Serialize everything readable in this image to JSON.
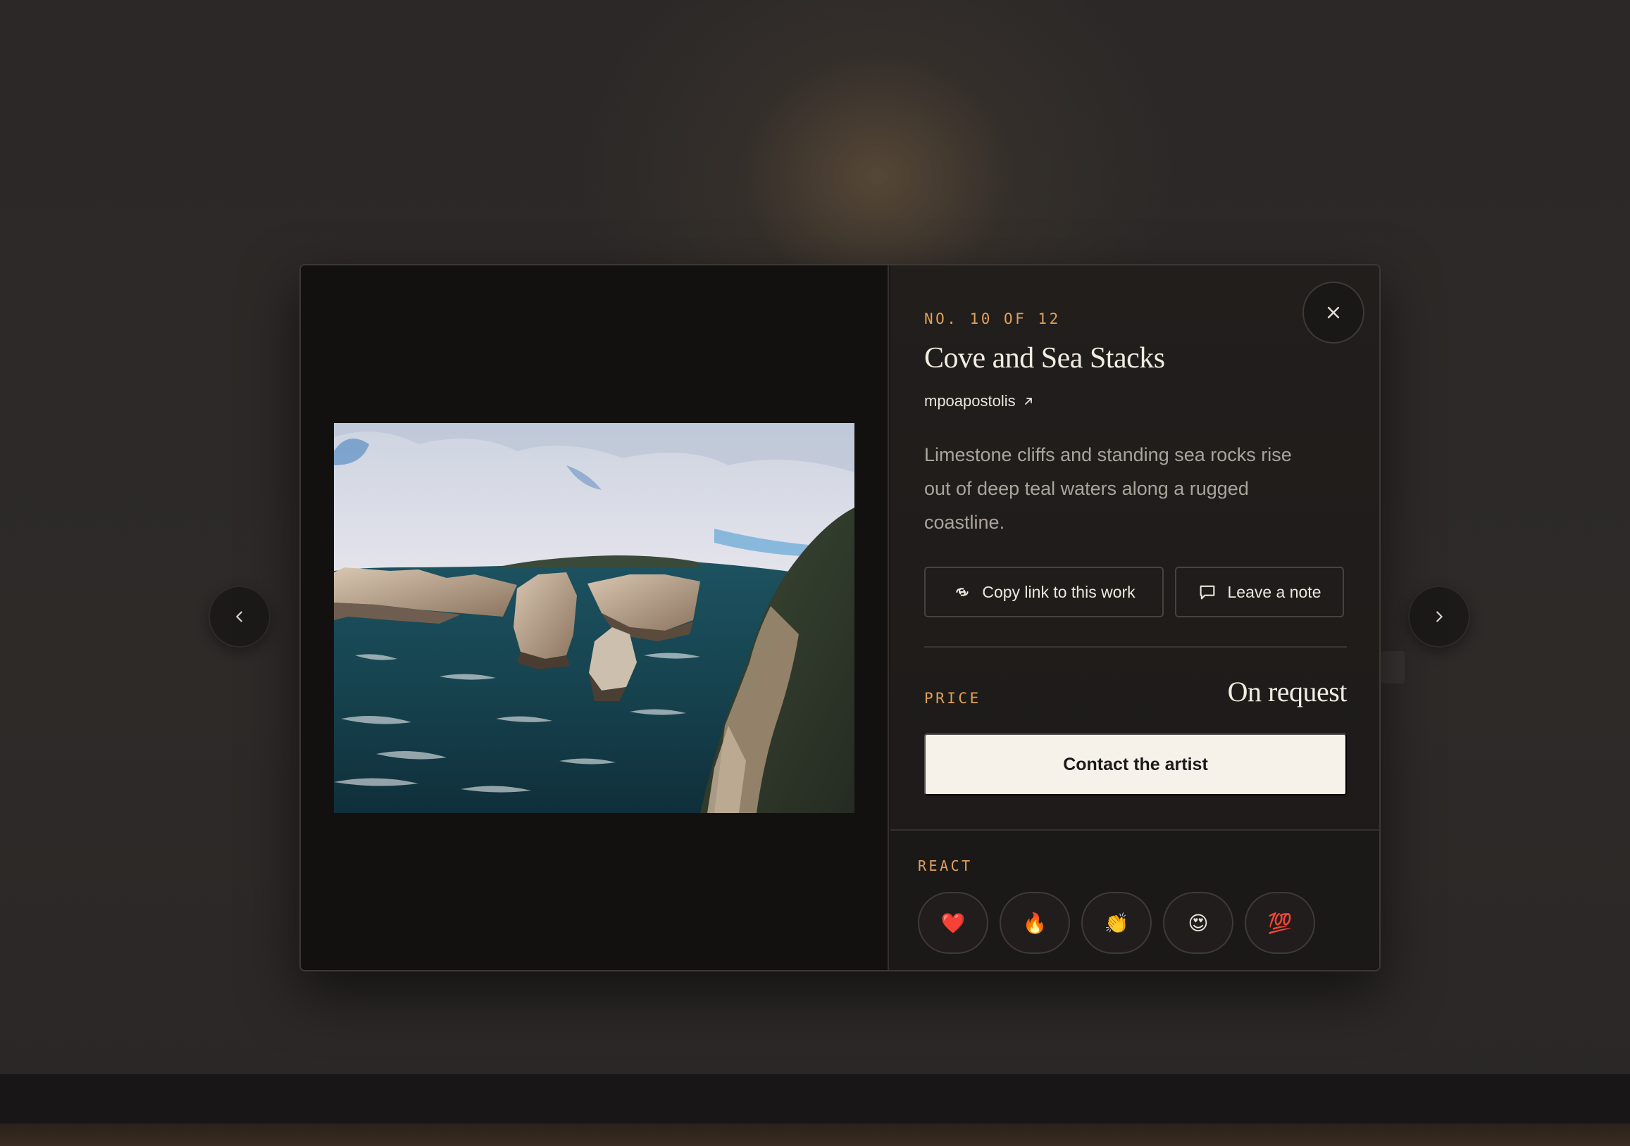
{
  "modal": {
    "counter": "NO. 10 OF 12",
    "title": "Cove and Sea Stacks",
    "artist": "mpoapostolis",
    "description": "Limestone cliffs and standing sea rocks rise out of deep teal waters along a rugged coastline.",
    "actions": {
      "copy_link": "Copy link to this work",
      "leave_note": "Leave a note"
    },
    "price": {
      "label": "PRICE",
      "value": "On request"
    },
    "contact_button": "Contact the artist",
    "react": {
      "label": "REACT",
      "reactions": [
        "❤️",
        "🔥",
        "👏",
        "😍",
        "💯"
      ]
    }
  },
  "icons": {
    "close": "close-icon",
    "prev": "chevron-left-icon",
    "next": "chevron-right-icon",
    "external": "arrow-up-right-icon",
    "link": "link-icon",
    "comment": "comment-icon"
  },
  "colors": {
    "accent": "#e0a05a",
    "primary_button_bg": "#f6f1e9",
    "modal_bg": "#1a1817",
    "text_primary": "#f1ebe1",
    "text_muted": "#a9a39b"
  }
}
